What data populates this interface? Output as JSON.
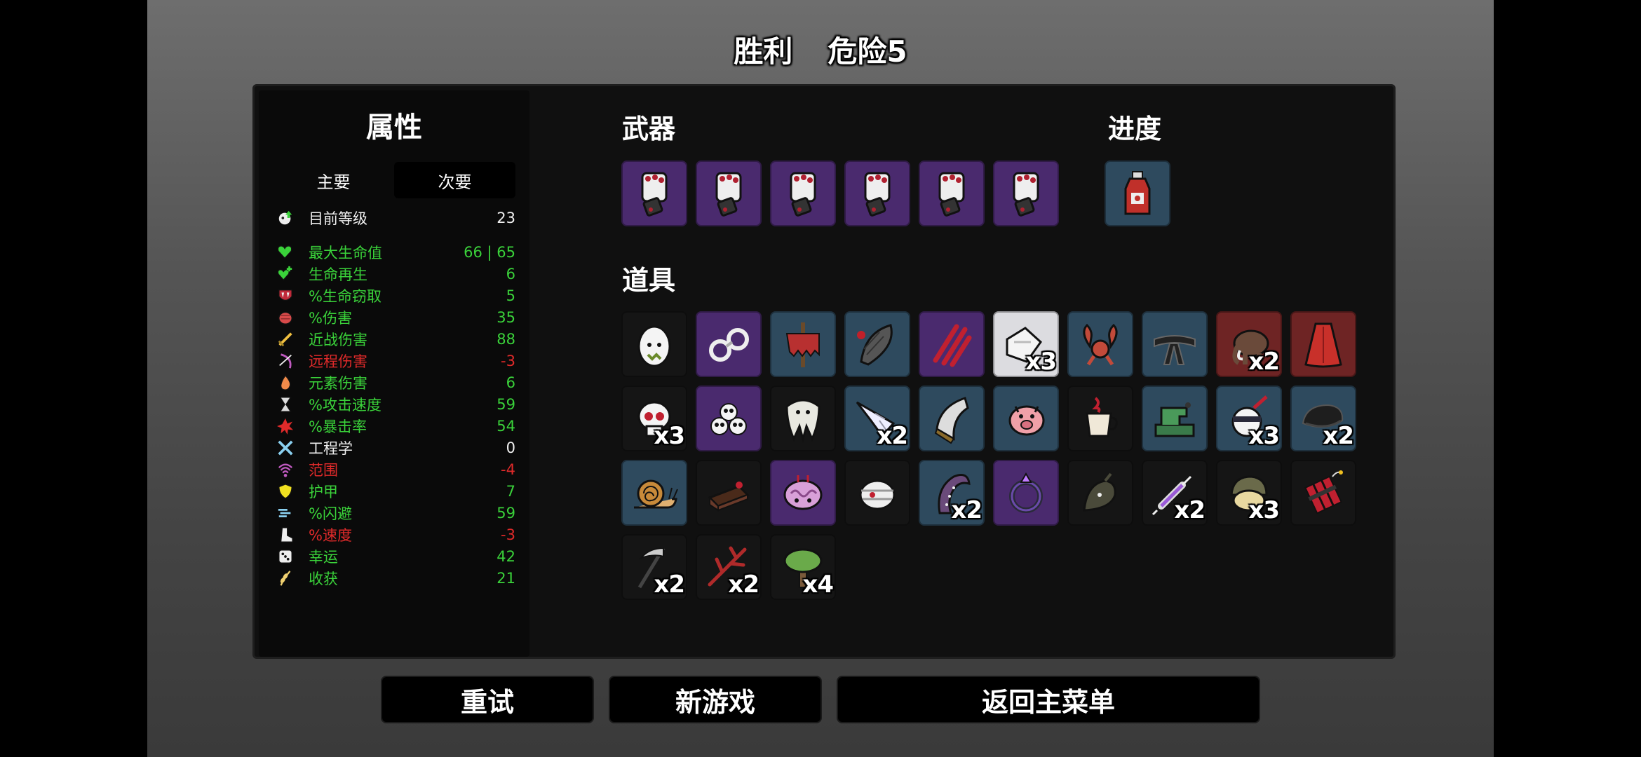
{
  "title": {
    "result": "胜利",
    "danger": "危险5"
  },
  "stats": {
    "title": "属性",
    "tabs": [
      {
        "label": "主要",
        "active": false
      },
      {
        "label": "次要",
        "active": true
      }
    ],
    "level": {
      "icon": "level-up-icon",
      "label": "目前等级",
      "value": "23"
    },
    "rows": [
      {
        "icon": "heart-icon",
        "label": "最大生命值",
        "value": "66 | 65",
        "color": "green"
      },
      {
        "icon": "heart-regen-icon",
        "label": "生命再生",
        "value": "6",
        "color": "green"
      },
      {
        "icon": "fangs-icon",
        "label": "%生命窃取",
        "value": "5",
        "color": "green"
      },
      {
        "icon": "fist-icon",
        "label": "%伤害",
        "value": "35",
        "color": "green"
      },
      {
        "icon": "sword-icon",
        "label": "近战伤害",
        "value": "88",
        "color": "green"
      },
      {
        "icon": "bow-icon",
        "label": "远程伤害",
        "value": "-3",
        "color": "red"
      },
      {
        "icon": "flame-icon",
        "label": "元素伤害",
        "value": "6",
        "color": "green"
      },
      {
        "icon": "hourglass-icon",
        "label": "%攻击速度",
        "value": "59",
        "color": "green"
      },
      {
        "icon": "crit-burst-icon",
        "label": "%暴击率",
        "value": "54",
        "color": "green"
      },
      {
        "icon": "wrench-icon",
        "label": "工程学",
        "value": "0",
        "color": "white"
      },
      {
        "icon": "range-icon",
        "label": "范围",
        "value": "-4",
        "color": "red"
      },
      {
        "icon": "shield-icon",
        "label": "护甲",
        "value": "7",
        "color": "green"
      },
      {
        "icon": "dodge-icon",
        "label": "%闪避",
        "value": "59",
        "color": "green"
      },
      {
        "icon": "boot-icon",
        "label": "%速度",
        "value": "-3",
        "color": "red"
      },
      {
        "icon": "dice-icon",
        "label": "幸运",
        "value": "42",
        "color": "green"
      },
      {
        "icon": "wheat-icon",
        "label": "收获",
        "value": "21",
        "color": "green"
      }
    ]
  },
  "weapons": {
    "title": "武器",
    "items": [
      {
        "name": "brass-knuckles",
        "tier": "tier3"
      },
      {
        "name": "brass-knuckles",
        "tier": "tier3"
      },
      {
        "name": "brass-knuckles",
        "tier": "tier3"
      },
      {
        "name": "brass-knuckles",
        "tier": "tier3"
      },
      {
        "name": "brass-knuckles",
        "tier": "tier3"
      },
      {
        "name": "brass-knuckles",
        "tier": "tier3"
      }
    ]
  },
  "progress": {
    "title": "进度",
    "items": [
      {
        "name": "ketchup-bottle",
        "tier": "tier2"
      }
    ]
  },
  "items": {
    "title": "道具",
    "list": [
      {
        "name": "egg",
        "tier": "tier1",
        "qty": ""
      },
      {
        "name": "handcuffs",
        "tier": "tier3",
        "qty": ""
      },
      {
        "name": "scarecrow",
        "tier": "tier2",
        "qty": ""
      },
      {
        "name": "leech",
        "tier": "tier2",
        "qty": ""
      },
      {
        "name": "claw-scratch",
        "tier": "tier3",
        "qty": ""
      },
      {
        "name": "cast-arm",
        "tier": "tier-white",
        "qty": "x3"
      },
      {
        "name": "crab-claws",
        "tier": "tier2",
        "qty": ""
      },
      {
        "name": "black-belt",
        "tier": "tier2",
        "qty": ""
      },
      {
        "name": "mammoth",
        "tier": "tier4",
        "qty": "x2"
      },
      {
        "name": "red-cape",
        "tier": "tier4",
        "qty": ""
      },
      {
        "name": "skull",
        "tier": "tier1",
        "qty": "x3"
      },
      {
        "name": "skull-pile",
        "tier": "tier3",
        "qty": ""
      },
      {
        "name": "tooth",
        "tier": "tier1",
        "qty": ""
      },
      {
        "name": "shard",
        "tier": "tier2",
        "qty": "x2"
      },
      {
        "name": "blade-piece",
        "tier": "tier2",
        "qty": ""
      },
      {
        "name": "piggy-bank",
        "tier": "tier2",
        "qty": ""
      },
      {
        "name": "coffee-cup",
        "tier": "tier1",
        "qty": ""
      },
      {
        "name": "sewing-machine",
        "tier": "tier2",
        "qty": ""
      },
      {
        "name": "ninja-ball",
        "tier": "tier2",
        "qty": "x3"
      },
      {
        "name": "black-beret",
        "tier": "tier2",
        "qty": "x2"
      },
      {
        "name": "snail",
        "tier": "tier2",
        "qty": ""
      },
      {
        "name": "cake-slice",
        "tier": "tier1",
        "qty": ""
      },
      {
        "name": "brain",
        "tier": "tier3",
        "qty": ""
      },
      {
        "name": "mummy-head",
        "tier": "tier1",
        "qty": ""
      },
      {
        "name": "tentacle",
        "tier": "tier2",
        "qty": "x2"
      },
      {
        "name": "ring",
        "tier": "tier3",
        "qty": ""
      },
      {
        "name": "ghost-blob",
        "tier": "tier1",
        "qty": ""
      },
      {
        "name": "syringe",
        "tier": "tier1",
        "qty": "x2"
      },
      {
        "name": "helmet-creature",
        "tier": "tier1",
        "qty": "x3"
      },
      {
        "name": "dynamite",
        "tier": "tier1",
        "qty": ""
      },
      {
        "name": "scythe",
        "tier": "tier1",
        "qty": "x2"
      },
      {
        "name": "red-branch",
        "tier": "tier1",
        "qty": "x2"
      },
      {
        "name": "tree",
        "tier": "tier1",
        "qty": "x4"
      }
    ]
  },
  "buttons": {
    "retry": "重试",
    "new_game": "新游戏",
    "main_menu": "返回主菜单"
  },
  "colors": {
    "green": "#3ad23a",
    "red": "#e02a2a",
    "tier3": "#4a2a6e",
    "tier2": "#2e4a5e",
    "tier4": "#6e2424"
  }
}
